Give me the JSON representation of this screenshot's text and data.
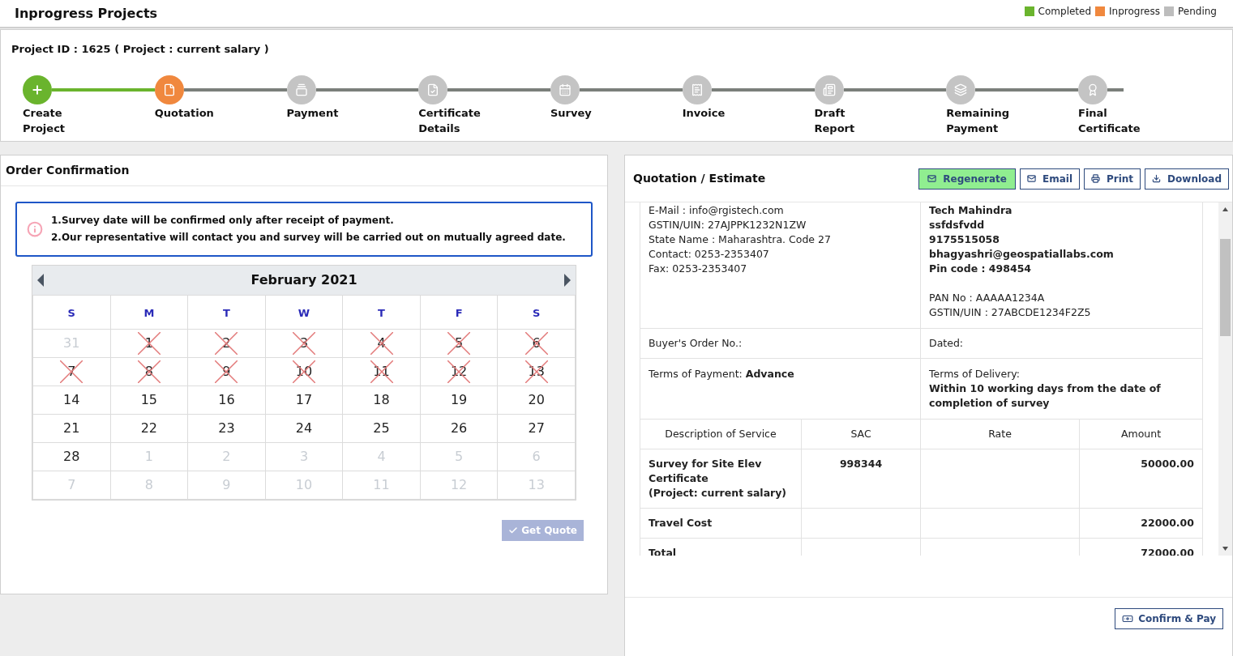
{
  "header": {
    "title": "Inprogress Projects",
    "legend": [
      {
        "label": "Completed",
        "color": "#6ab42d"
      },
      {
        "label": "Inprogress",
        "color": "#f0883e"
      },
      {
        "label": "Pending",
        "color": "#bdbdbd"
      }
    ]
  },
  "project": {
    "heading": "Project ID : 1625 ( Project : current salary )",
    "steps": [
      {
        "lines": [
          "Create",
          "Project"
        ],
        "done": true,
        "current": false
      },
      {
        "lines": [
          "Quotation"
        ],
        "done": false,
        "current": true
      },
      {
        "lines": [
          "Payment"
        ],
        "done": false,
        "current": false
      },
      {
        "lines": [
          "Certificate",
          "Details"
        ],
        "done": false,
        "current": false
      },
      {
        "lines": [
          "Survey"
        ],
        "done": false,
        "current": false
      },
      {
        "lines": [
          "Invoice"
        ],
        "done": false,
        "current": false
      },
      {
        "lines": [
          "Draft",
          "Report"
        ],
        "done": false,
        "current": false
      },
      {
        "lines": [
          "Remaining",
          "Payment"
        ],
        "done": false,
        "current": false
      },
      {
        "lines": [
          "Final",
          "Certificate"
        ],
        "done": false,
        "current": false
      }
    ]
  },
  "order": {
    "title": "Order Confirmation",
    "notes": [
      "1.Survey date will be confirmed only after receipt of payment.",
      "2.Our representative will contact you and survey will be carried out on mutually agreed date."
    ],
    "calendar": {
      "month": "February 2021",
      "weekdays": [
        "S",
        "M",
        "T",
        "W",
        "T",
        "F",
        "S"
      ],
      "weeks": [
        [
          {
            "day": "31",
            "kind": "muted"
          },
          {
            "day": "1",
            "kind": "crossed"
          },
          {
            "day": "2",
            "kind": "crossed"
          },
          {
            "day": "3",
            "kind": "crossed"
          },
          {
            "day": "4",
            "kind": "crossed"
          },
          {
            "day": "5",
            "kind": "crossed"
          },
          {
            "day": "6",
            "kind": "crossed"
          }
        ],
        [
          {
            "day": "7",
            "kind": "crossed"
          },
          {
            "day": "8",
            "kind": "crossed"
          },
          {
            "day": "9",
            "kind": "crossed"
          },
          {
            "day": "10",
            "kind": "crossed"
          },
          {
            "day": "11",
            "kind": "crossed"
          },
          {
            "day": "12",
            "kind": "crossed"
          },
          {
            "day": "13",
            "kind": "crossed"
          }
        ],
        [
          {
            "day": "14",
            "kind": "normal"
          },
          {
            "day": "15",
            "kind": "normal"
          },
          {
            "day": "16",
            "kind": "normal"
          },
          {
            "day": "17",
            "kind": "normal"
          },
          {
            "day": "18",
            "kind": "normal"
          },
          {
            "day": "19",
            "kind": "normal"
          },
          {
            "day": "20",
            "kind": "normal"
          }
        ],
        [
          {
            "day": "21",
            "kind": "normal"
          },
          {
            "day": "22",
            "kind": "normal"
          },
          {
            "day": "23",
            "kind": "normal"
          },
          {
            "day": "24",
            "kind": "normal"
          },
          {
            "day": "25",
            "kind": "normal"
          },
          {
            "day": "26",
            "kind": "normal"
          },
          {
            "day": "27",
            "kind": "normal"
          }
        ],
        [
          {
            "day": "28",
            "kind": "normal"
          },
          {
            "day": "1",
            "kind": "muted"
          },
          {
            "day": "2",
            "kind": "muted"
          },
          {
            "day": "3",
            "kind": "muted"
          },
          {
            "day": "4",
            "kind": "muted"
          },
          {
            "day": "5",
            "kind": "muted"
          },
          {
            "day": "6",
            "kind": "muted"
          }
        ],
        [
          {
            "day": "7",
            "kind": "muted"
          },
          {
            "day": "8",
            "kind": "muted"
          },
          {
            "day": "9",
            "kind": "muted"
          },
          {
            "day": "10",
            "kind": "muted"
          },
          {
            "day": "11",
            "kind": "muted"
          },
          {
            "day": "12",
            "kind": "muted"
          },
          {
            "day": "13",
            "kind": "muted"
          }
        ]
      ]
    },
    "get_quote": {
      "label": "Get Quote",
      "disabled": true
    }
  },
  "quotation": {
    "title": "Quotation / Estimate",
    "actions": [
      {
        "label": "Regenerate",
        "kind": "regenerate"
      },
      {
        "label": "Email",
        "kind": "email"
      },
      {
        "label": "Print",
        "kind": "print"
      },
      {
        "label": "Download",
        "kind": "download"
      }
    ],
    "seller_lines": [
      "E-Mail : info@rgistech.com",
      "GSTIN/UIN: 27AJPPK1232N1ZW",
      "State Name : Maharashtra. Code 27",
      "Contact: 0253-2353407",
      "Fax: 0253-2353407"
    ],
    "buyer_contact": [
      "Tech Mahindra",
      "ssfdsfvdd",
      "9175515058",
      "bhagyashri@geospatiallabs.com",
      "Pin code : 498454"
    ],
    "buyer_tax": [
      "PAN No : AAAAA1234A",
      "GSTIN/UIN : 27ABCDE1234F2Z5"
    ],
    "buyer_order": "Buyer's Order No.:",
    "dated": "Dated:",
    "terms_payment": "Terms of Payment: **Advance**",
    "terms_delivery_label": "Terms of Delivery:",
    "terms_delivery": "Within 10 working days from the date of completion of survey",
    "table": {
      "columns": [
        "Description of Service",
        "SAC",
        "Rate",
        "Amount"
      ],
      "rows": [
        {
          "cells": [
            "Survey for Site Elev Certificate\n(Project: current salary)",
            "998344",
            "",
            "50000.00"
          ]
        },
        {
          "cells": [
            "Travel Cost",
            "",
            "",
            "22000.00"
          ]
        },
        {
          "cells": [
            "Total",
            "",
            "",
            "72000.00"
          ]
        }
      ]
    },
    "confirm": "Confirm & Pay"
  }
}
